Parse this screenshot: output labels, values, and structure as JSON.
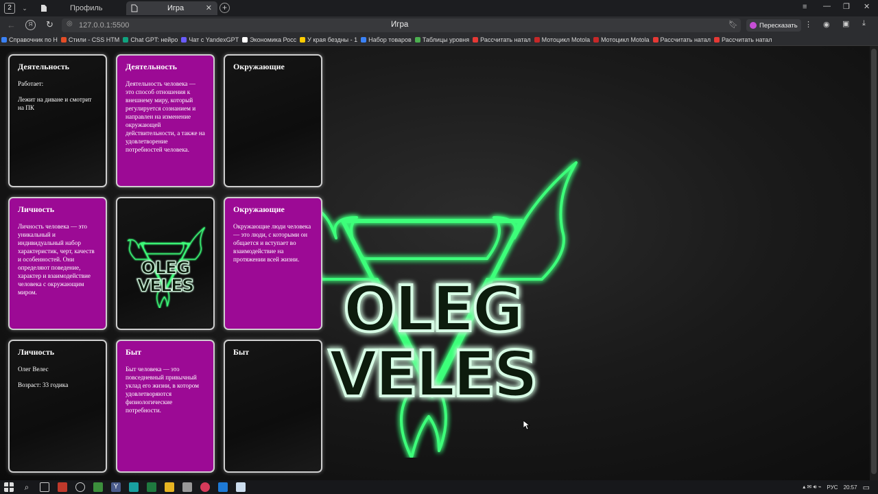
{
  "browser": {
    "tab_count": "2",
    "tabs": [
      {
        "label": "Профиль"
      },
      {
        "label": "Игра"
      }
    ],
    "url": "127.0.0.1:5500",
    "page_title": "Игра",
    "retell_label": "Пересказать",
    "bookmarks": [
      {
        "label": "Справочник по Н",
        "color": "#3b82f6"
      },
      {
        "label": "Стили - CSS HTM",
        "color": "#e44d26"
      },
      {
        "label": "Chat GPT: нейро",
        "color": "#10a37f"
      },
      {
        "label": "Чат с YandexGPT",
        "color": "#6a5cff"
      },
      {
        "label": "Экономика Росс",
        "color": "#ffffff"
      },
      {
        "label": "У края бездны - 1",
        "color": "#ffcc00"
      },
      {
        "label": "Набор товаров",
        "color": "#3b82f6"
      },
      {
        "label": "Таблицы уровня",
        "color": "#4caf50"
      },
      {
        "label": "Рассчитать натал",
        "color": "#e53935"
      },
      {
        "label": "Мотоцикл Motola",
        "color": "#c62828"
      },
      {
        "label": "Мотоцикл Motola",
        "color": "#c62828"
      },
      {
        "label": "Рассчитать натал",
        "color": "#e53935"
      },
      {
        "label": "Рассчитать натал",
        "color": "#e53935"
      }
    ]
  },
  "cards": [
    {
      "title": "Деятельность",
      "paragraphs": [
        "Работает:",
        "Лежит на диване и смотрит на ПК"
      ],
      "style": "dark"
    },
    {
      "title": "Деятельность",
      "paragraphs": [
        "Деятельность человека — это способ отношения к внешнему миру, который регулируется сознанием и направлен на изменение окружающей действительности, а также на удовлетворение потребностей человека."
      ],
      "style": "pink"
    },
    {
      "title": "Окружающие",
      "paragraphs": [],
      "style": "dark"
    },
    {
      "title": "Личность",
      "paragraphs": [
        "Личность человека — это уникальный и индивидуальный набор характеристик, черт, качеств и особенностей. Они определяют поведение, характер и взаимодействие человека с окружающим миром."
      ],
      "style": "pink"
    },
    {
      "title": "",
      "paragraphs": [],
      "style": "logo"
    },
    {
      "title": "Окружающие",
      "paragraphs": [
        "Окружающие люди человека — это люди, с которыми он общается и вступает во взаимодействие на протяжении всей жизни."
      ],
      "style": "pink"
    },
    {
      "title": "Личность",
      "paragraphs": [
        "Олег Велес",
        "Возраст: 33 годика"
      ],
      "style": "dark"
    },
    {
      "title": "Быт",
      "paragraphs": [
        "Быт человека — это повседневный привычный уклад его жизни, в котором удовлетворяются физиологические потребности."
      ],
      "style": "pink"
    },
    {
      "title": "Быт",
      "paragraphs": [],
      "style": "dark"
    }
  ],
  "logo": {
    "line1": "OLEG",
    "line2": "VELES",
    "glow_color": "#3dff7a"
  },
  "taskbar": {
    "language": "РУС",
    "time": "20:57"
  },
  "colors": {
    "card_pink": "#9c0a95",
    "background": "#1a1a1a"
  }
}
